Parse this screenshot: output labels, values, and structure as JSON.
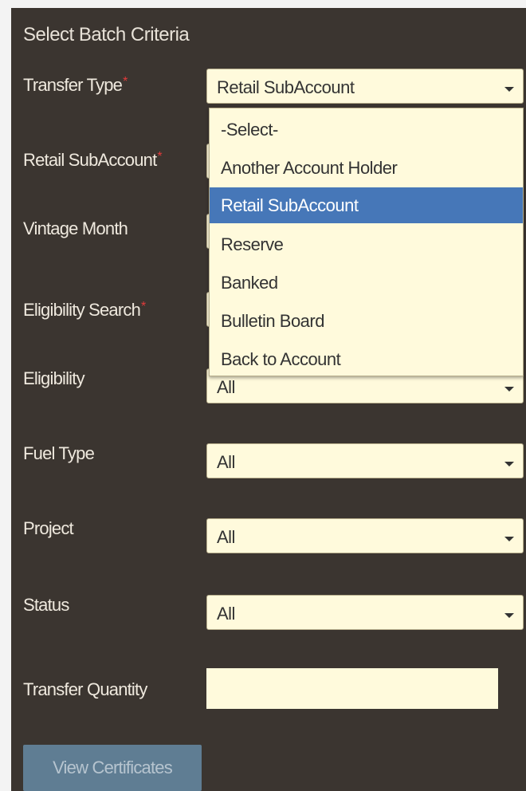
{
  "panel": {
    "title": "Select Batch Criteria",
    "required_mark": "*"
  },
  "fields": {
    "transfer_type": {
      "label": "Transfer Type",
      "value": "Retail SubAccount"
    },
    "retail_subaccount": {
      "label": "Retail SubAccount"
    },
    "vintage_month": {
      "label": "Vintage Month"
    },
    "eligibility_search": {
      "label": "Eligibility Search"
    },
    "eligibility": {
      "label": "Eligibility",
      "value": "All"
    },
    "fuel_type": {
      "label": "Fuel Type",
      "value": "All"
    },
    "project": {
      "label": "Project",
      "value": "All"
    },
    "status": {
      "label": "Status",
      "value": "All"
    },
    "transfer_quantity": {
      "label": "Transfer Quantity",
      "value": ""
    }
  },
  "dropdown": {
    "options": [
      "-Select-",
      "Another Account Holder",
      "Retail SubAccount",
      "Reserve",
      "Banked",
      "Bulletin Board",
      "Back to Account"
    ],
    "selected": "Retail SubAccount"
  },
  "actions": {
    "view_label": "View Certificates"
  },
  "colors": {
    "panel_bg": "#3b3530",
    "field_bg": "#fffadc",
    "selected_option_bg": "#4677b8",
    "required_mark": "#e23b3b",
    "button_bg": "#5f7d93"
  }
}
